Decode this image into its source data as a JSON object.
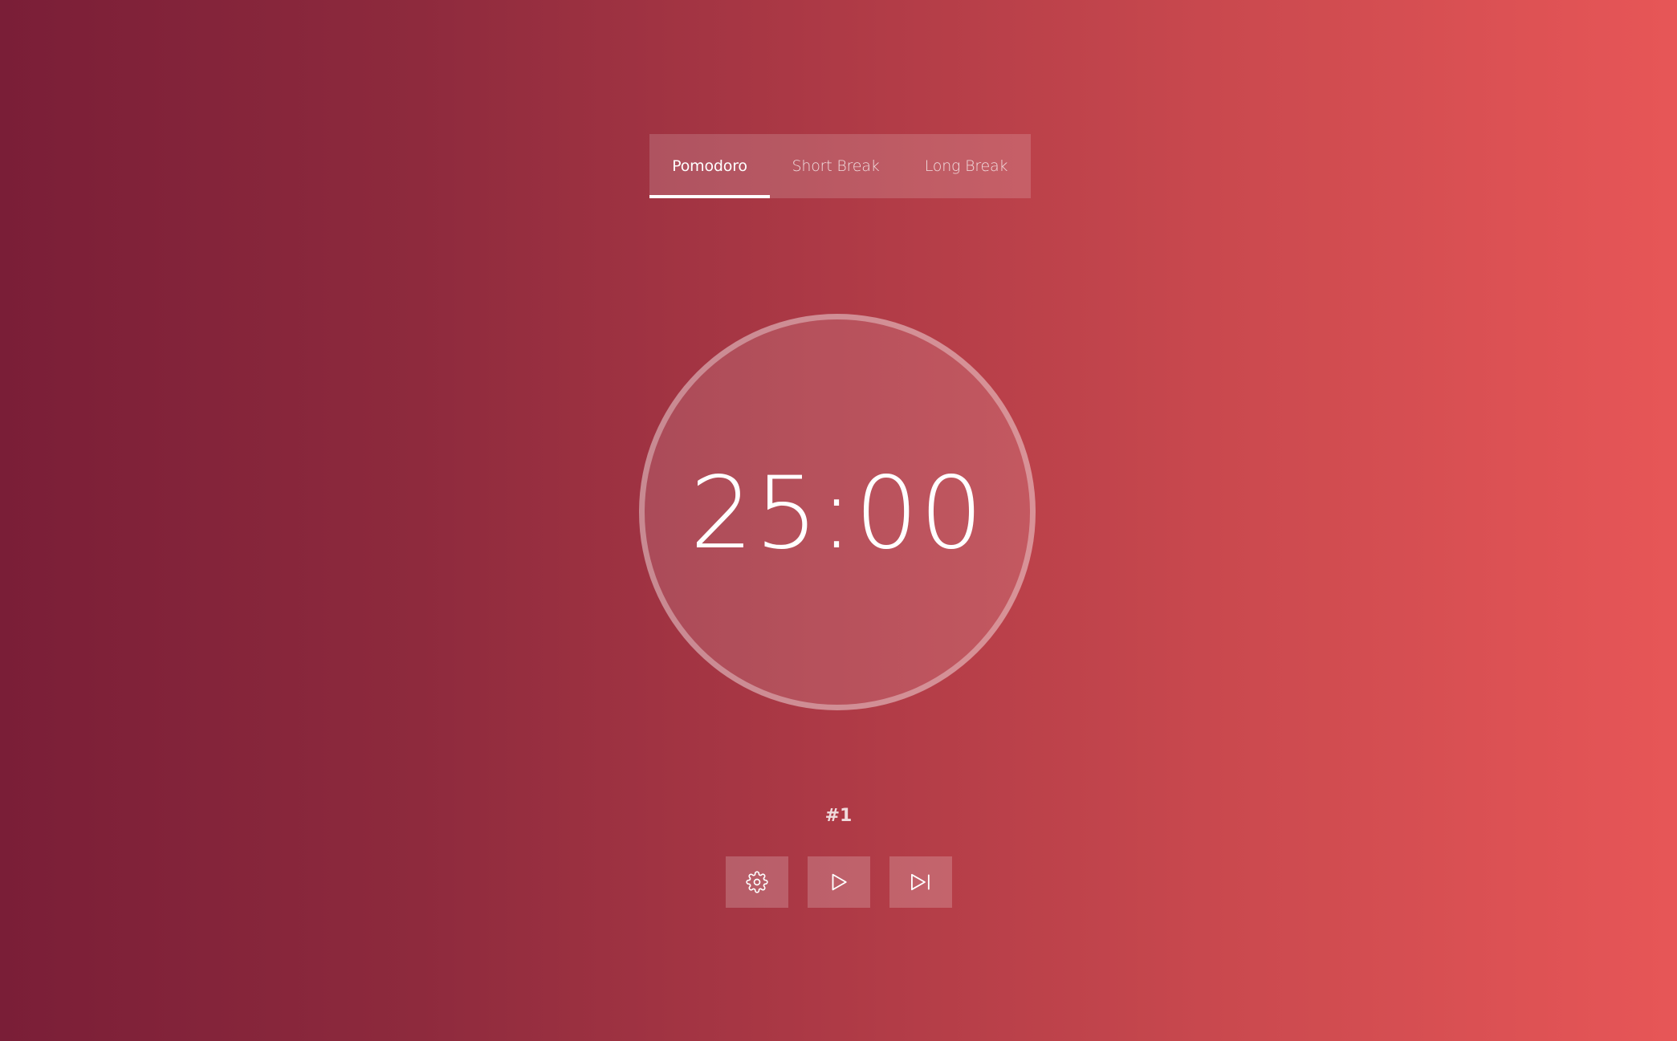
{
  "tabs": [
    {
      "label": "Pomodoro",
      "active": true
    },
    {
      "label": "Short Break",
      "active": false
    },
    {
      "label": "Long Break",
      "active": false
    }
  ],
  "timer": {
    "display": "25:00"
  },
  "session": {
    "label": "#1"
  },
  "controls": {
    "settings_icon": "gear-icon",
    "play_icon": "play-icon",
    "skip_icon": "skip-forward-icon"
  },
  "colors": {
    "gradient_start": "#7a1e37",
    "gradient_end": "#e75657",
    "text": "#ffffff"
  }
}
